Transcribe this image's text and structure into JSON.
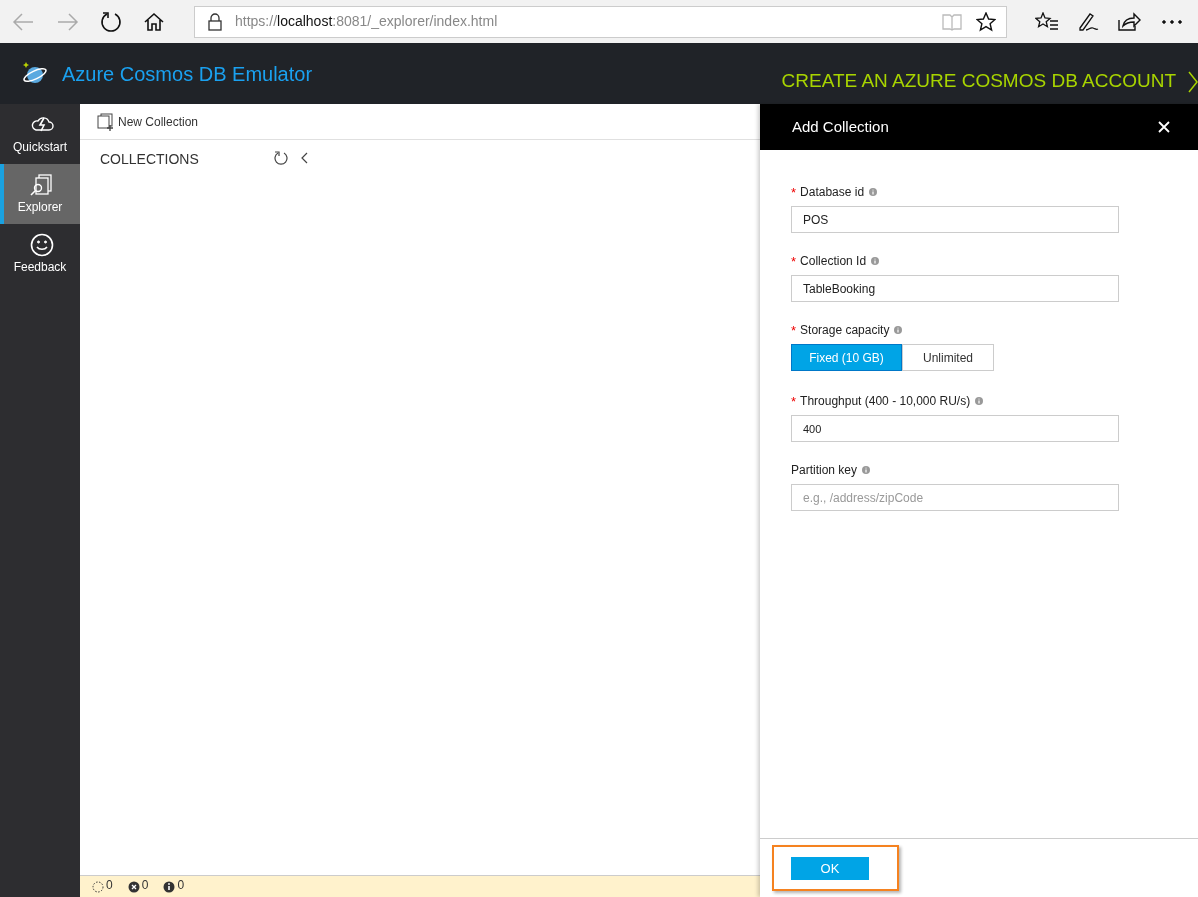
{
  "browser": {
    "url": {
      "scheme": "https://",
      "host": "localhost",
      "path": ":8081/_explorer/index.html"
    }
  },
  "header": {
    "title": "Azure Cosmos DB Emulator",
    "link": "CREATE AN AZURE COSMOS DB ACCOUNT"
  },
  "sidebar": {
    "items": [
      {
        "kind": "quickstart",
        "label": "Quickstart",
        "selected": false
      },
      {
        "kind": "explorer",
        "label": "Explorer",
        "selected": true
      },
      {
        "kind": "feedback",
        "label": "Feedback",
        "selected": false
      }
    ]
  },
  "toolbar": {
    "new_collection": "New Collection"
  },
  "collections": {
    "heading": "COLLECTIONS"
  },
  "status_bar": [
    {
      "kind": "pending",
      "count": "0"
    },
    {
      "kind": "error",
      "count": "0"
    },
    {
      "kind": "info",
      "count": "0"
    }
  ],
  "panel": {
    "title": "Add Collection",
    "required_marker": "*",
    "fields": [
      {
        "kind": "text",
        "label": "Database id",
        "required": true,
        "value": "POS"
      },
      {
        "kind": "text",
        "label": "Collection Id",
        "required": true,
        "value": "TableBooking"
      },
      {
        "kind": "toggle",
        "label": "Storage capacity",
        "required": true,
        "options": [
          {
            "label": "Fixed (10 GB)",
            "selected": true
          },
          {
            "label": "Unlimited",
            "selected": false
          }
        ]
      },
      {
        "kind": "number",
        "label": "Throughput (400 - 10,000 RU/s)",
        "required": true,
        "value": "400"
      },
      {
        "kind": "text",
        "label": "Partition key",
        "required": false,
        "placeholder": "e.g., /address/zipCode"
      }
    ],
    "ok_button": {
      "label": "OK",
      "highlighted": true
    }
  }
}
